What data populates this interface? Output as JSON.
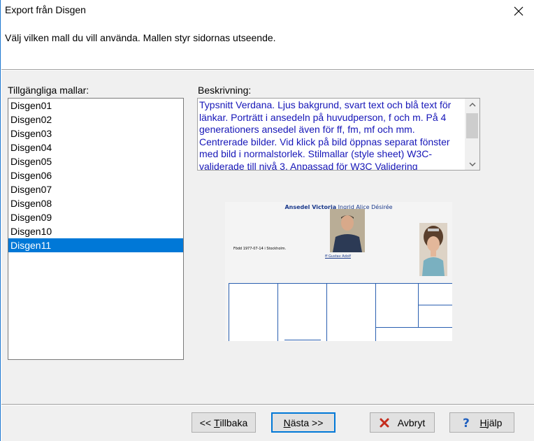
{
  "window": {
    "title": "Export från Disgen",
    "close_glyph": "✕"
  },
  "header": {
    "instruction": "Välj vilken mall du vill använda. Mallen styr sidornas utseende."
  },
  "templates": {
    "label": "Tillgängliga mallar:",
    "items": [
      "Disgen01",
      "Disgen02",
      "Disgen03",
      "Disgen04",
      "Disgen05",
      "Disgen06",
      "Disgen07",
      "Disgen08",
      "Disgen09",
      "Disgen10",
      "Disgen11"
    ],
    "selected_index": 10
  },
  "description": {
    "label": "Beskrivning:",
    "text": "Typsnitt Verdana.  Ljus bakgrund, svart text och blå text för länkar. Porträtt i ansedeln på huvudperson, f och m. På 4 generationers ansedel även för ff, fm, mf och mm. Centrerade bilder. Vid klick på bild öppnas separat fönster med bild i normalstorlek. Stilmallar (style sheet) W3C-validerade till nivå 3. Anpassad för W3C Validering",
    "text_color": "#1616b8"
  },
  "preview": {
    "title_bold": "Ansedel Victoria",
    "title_rest": " Ingrid Alice Désirée",
    "year": "1977-",
    "born": "Född 1977-07-14 i Stockholm.",
    "father_name": "Gustav Adolf",
    "father_prefix": "ff",
    "accent": "#1b3a8c"
  },
  "buttons": {
    "back_prefix": "<< ",
    "back_u": "T",
    "back_rest": "illbaka",
    "next_u": "N",
    "next_rest": "ästa >>",
    "cancel": "Avbryt",
    "help_u": "H",
    "help_rest": "jälp"
  },
  "colors": {
    "selection": "#0078d7",
    "cancel_icon": "#c42b1c",
    "help_icon": "#1f5fbf"
  }
}
